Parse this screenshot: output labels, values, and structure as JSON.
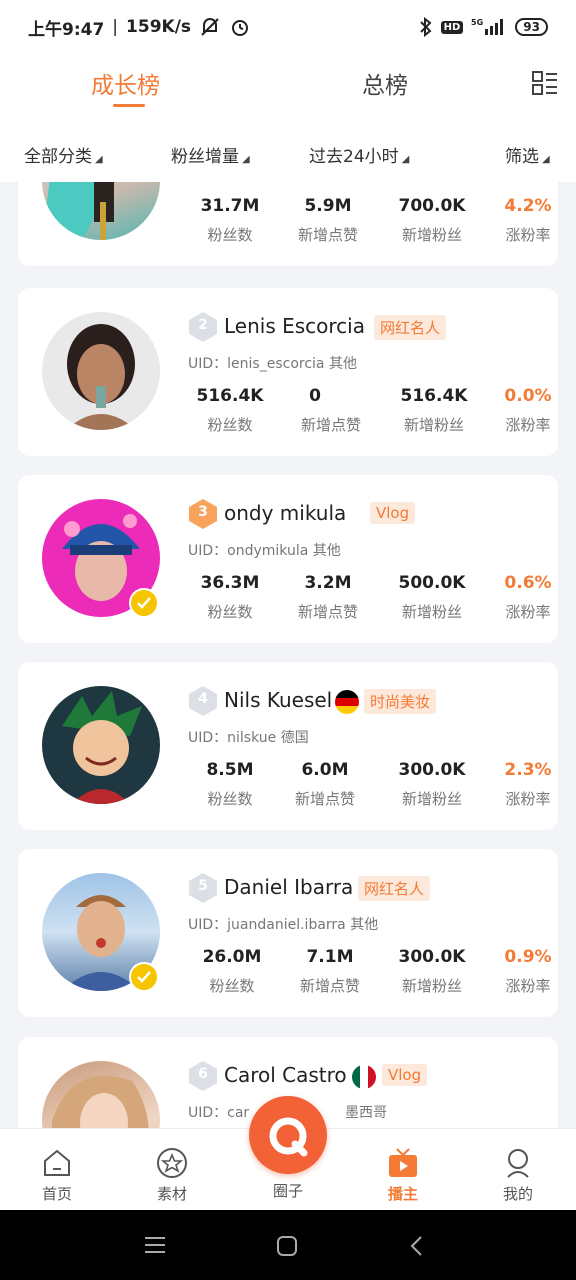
{
  "status_bar": {
    "time": "上午9:47",
    "speed": "159K/s",
    "battery": "93"
  },
  "header": {
    "tabs": [
      {
        "label": "成长榜",
        "active": true
      },
      {
        "label": "总榜",
        "active": false
      }
    ],
    "menu_icon": "list-menu-icon"
  },
  "filters": [
    {
      "label": "全部分类"
    },
    {
      "label": "粉丝增量"
    },
    {
      "label": "过去24小时"
    },
    {
      "label": "筛选"
    }
  ],
  "stat_labels": {
    "fans": "粉丝数",
    "likes": "新增点赞",
    "new_fans": "新增粉丝",
    "rate": "涨粉率"
  },
  "cards": [
    {
      "rank": "",
      "name": "",
      "uid": "",
      "fans": "31.7M",
      "likes": "5.9M",
      "new_fans": "700.0K",
      "rate": "4.2%"
    },
    {
      "rank": "2",
      "name": "Lenis Escorcia",
      "tag": "网红名人",
      "uid": "UID：lenis_escorcia   其他",
      "fans": "516.4K",
      "likes": "0",
      "new_fans": "516.4K",
      "rate": "0.0%"
    },
    {
      "rank": "3",
      "name": "ondy mikula",
      "tag": "Vlog",
      "uid": "UID：ondymikula   其他",
      "fans": "36.3M",
      "likes": "3.2M",
      "new_fans": "500.0K",
      "rate": "0.6%"
    },
    {
      "rank": "4",
      "name": "Nils Kuesel",
      "tag": "时尚美妆",
      "uid": "UID：nilskue   德国",
      "fans": "8.5M",
      "likes": "6.0M",
      "new_fans": "300.0K",
      "rate": "2.3%"
    },
    {
      "rank": "5",
      "name": "Daniel Ibarra",
      "tag": "网红名人",
      "uid": "UID：juandaniel.ibarra   其他",
      "fans": "26.0M",
      "likes": "7.1M",
      "new_fans": "300.0K",
      "rate": "0.9%"
    },
    {
      "rank": "6",
      "name": "Carol Castro",
      "tag": "Vlog",
      "uid_prefix": "UID：car",
      "country": "墨西哥"
    }
  ],
  "bottom_nav": [
    {
      "label": "首页",
      "icon": "home-icon"
    },
    {
      "label": "素材",
      "icon": "star-icon"
    },
    {
      "label": "圈子",
      "icon": "circle-q-icon"
    },
    {
      "label": "播主",
      "icon": "tv-play-icon",
      "active": true
    },
    {
      "label": "我的",
      "icon": "profile-icon"
    }
  ],
  "colors": {
    "accent": "#f37b35",
    "fab": "#f26236",
    "tag_bg": "#fde9dc"
  }
}
